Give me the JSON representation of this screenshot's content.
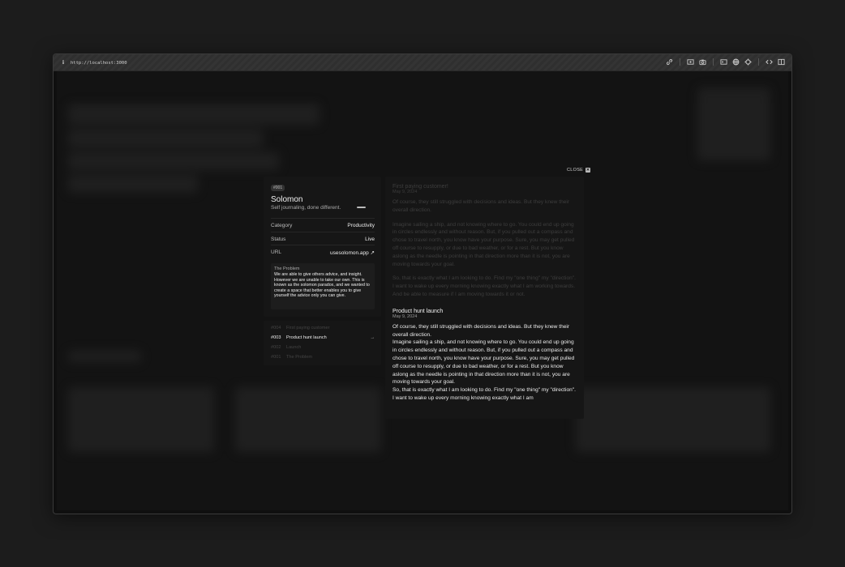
{
  "browser": {
    "info_glyph": "i",
    "url": "http://localhost:3000",
    "tool_icons": [
      "link-icon",
      "image-icon",
      "camera-icon",
      "terminal-icon",
      "globe-icon",
      "crosshair-icon",
      "code-icon",
      "sidebar-icon"
    ]
  },
  "modal": {
    "close_label": "CLOSE"
  },
  "project": {
    "tag": "#001",
    "title": "Solomon",
    "subtitle": "Self journaling, done different.",
    "details": [
      {
        "label": "Category",
        "value": "Productivity"
      },
      {
        "label": "Status",
        "value": "Live"
      },
      {
        "label": "URL",
        "value": "usesolomon.app ↗"
      }
    ],
    "problem": {
      "heading": "The Problem",
      "body": "We are able to give others advice, and insight. However we are unable to take our own. This is known as the solomon paradox, and we wanted to create a space that better enables you to give yourself the advice only you can give."
    }
  },
  "timeline": {
    "items": [
      {
        "num": "#004",
        "label": "First paying customer",
        "active": false
      },
      {
        "num": "#003",
        "label": "Product hunt launch",
        "active": true,
        "arrow": "→"
      },
      {
        "num": "#002",
        "label": "Launch",
        "active": false
      },
      {
        "num": "#001",
        "label": "The Problem",
        "active": false
      }
    ]
  },
  "entries": [
    {
      "heading": "First paying customer!",
      "date": "May 9, 2024",
      "p1": "Of course, they still struggled with decisions and ideas. But they knew their overall direction.",
      "p2": "Imagine sailing a ship, and not knowing where to go. You could end up going in circles endlessly and without reason. But, if you pulled out a compass and chose to travel north, you know have your purpose. Sure, you may get pulled off course to resupply, or due to bad weather, or for a rest. But you know aslong as the needle is pointing in that direction more than it is not, you are moving towards your goal.",
      "p3": "So, that is exactly what I am looking to do. Find my \"one thing\" my \"direction\". I want to wake up every morning knowing exactly what I am working towards. And be able to measure if I am moving towards it or not."
    },
    {
      "heading": "Product hunt launch",
      "date": "May 9, 2024",
      "p1": "Of course, they still struggled with decisions and ideas. But they knew their overall direction.",
      "p2": "Imagine sailing a ship, and not knowing where to go. You could end up going in circles endlessly and without reason. But, if you pulled out a compass and chose to travel north, you know have your purpose. Sure, you may get pulled off course to resupply, or due to bad weather, or for a rest. But you know aslong as the needle is pointing in that direction more than it is not, you are moving towards your goal.",
      "p3": "So, that is exactly what I am looking to do. Find my \"one thing\" my \"direction\". I want to wake up every morning knowing exactly what I am"
    }
  ]
}
